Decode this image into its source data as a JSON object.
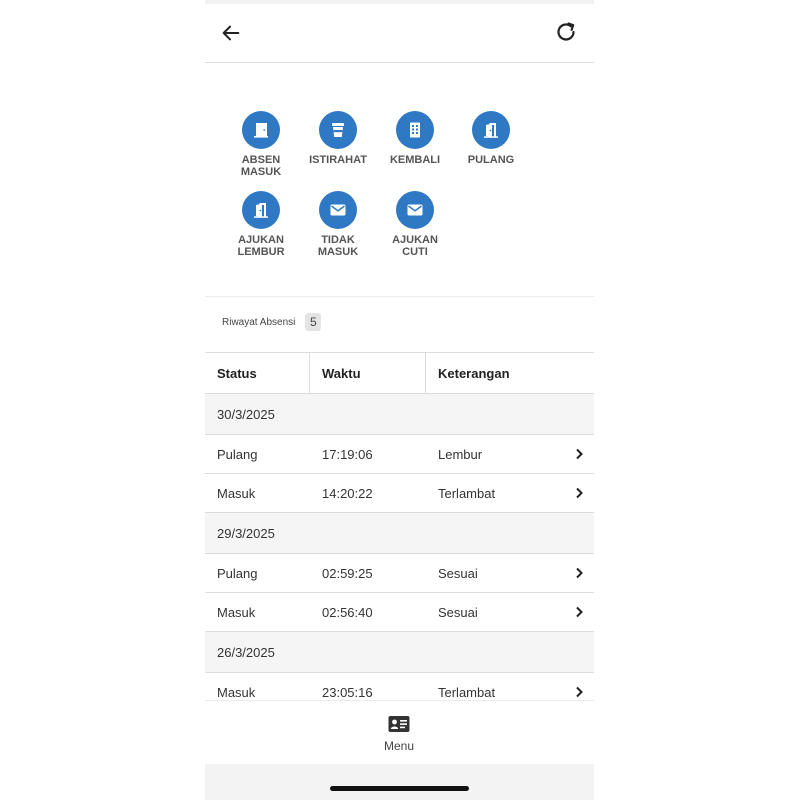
{
  "actions": [
    {
      "id": "absen-masuk",
      "line1": "ABSEN",
      "line2": "MASUK",
      "icon": "door-open-icon"
    },
    {
      "id": "istirahat",
      "line1": "ISTIRAHAT",
      "line2": "",
      "icon": "coffee-cup-icon"
    },
    {
      "id": "kembali",
      "line1": "KEMBALI",
      "line2": "",
      "icon": "building-icon"
    },
    {
      "id": "pulang",
      "line1": "PULANG",
      "line2": "",
      "icon": "door-exit-icon"
    },
    {
      "id": "ajukan-lembur",
      "line1": "AJUKAN",
      "line2": "LEMBUR",
      "icon": "door-exit-icon"
    },
    {
      "id": "tidak-masuk",
      "line1": "TIDAK",
      "line2": "MASUK",
      "icon": "envelope-icon"
    },
    {
      "id": "ajukan-cuti",
      "line1": "AJUKAN",
      "line2": "CUTI",
      "icon": "envelope-icon"
    }
  ],
  "history": {
    "title": "Riwayat Absensi",
    "count": "5",
    "columns": [
      "Status",
      "Waktu",
      "Keterangan"
    ],
    "groups": [
      {
        "date": "30/3/2025",
        "rows": [
          {
            "status": "Pulang",
            "time": "17:19:06",
            "note": "Lembur"
          },
          {
            "status": "Masuk",
            "time": "14:20:22",
            "note": "Terlambat"
          }
        ]
      },
      {
        "date": "29/3/2025",
        "rows": [
          {
            "status": "Pulang",
            "time": "02:59:25",
            "note": "Sesuai"
          },
          {
            "status": "Masuk",
            "time": "02:56:40",
            "note": "Sesuai"
          }
        ]
      },
      {
        "date": "26/3/2025",
        "rows": [
          {
            "status": "Masuk",
            "time": "23:05:16",
            "note": "Terlambat"
          }
        ]
      }
    ]
  },
  "nav": {
    "menu_label": "Menu",
    "menu_icon": "id-card-icon"
  },
  "colors": {
    "accent": "#2f78c4"
  }
}
